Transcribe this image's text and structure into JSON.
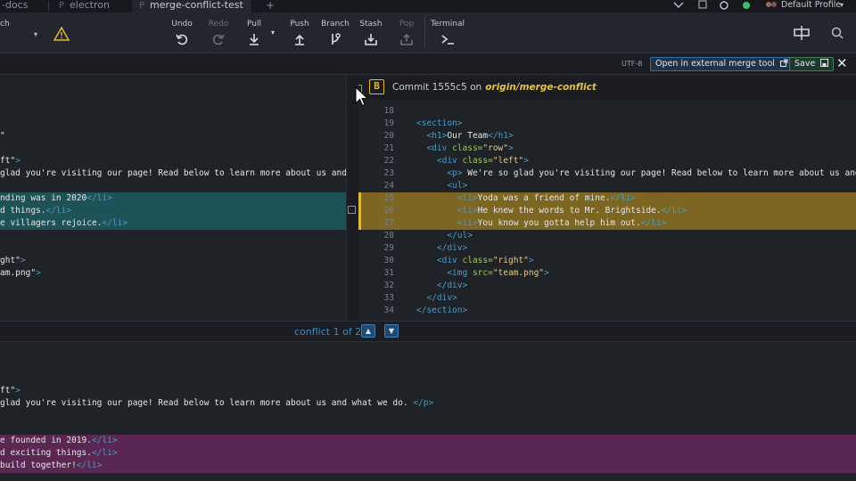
{
  "tabs": [
    {
      "prefix": "",
      "label": "-docs"
    },
    {
      "prefix": "P",
      "label": "electron"
    },
    {
      "prefix": "P",
      "label": "merge-conflict-test"
    }
  ],
  "tab_add": "+",
  "profile": "Default Profile",
  "toolbar": {
    "left_label": "ch",
    "undo": "Undo",
    "redo": "Redo",
    "pull": "Pull",
    "push": "Push",
    "branch": "Branch",
    "stash": "Stash",
    "pop": "Pop",
    "terminal": "Terminal"
  },
  "merge": {
    "encoding": "UTF-8",
    "open_external": "Open in external merge tool",
    "save": "Save",
    "close": "✕"
  },
  "commit": {
    "badge": "B",
    "text": "Commit 1555c5 on",
    "branch": "origin/merge-conflict"
  },
  "left_lines": [
    {
      "text": "\""
    },
    {
      "text": ""
    },
    {
      "text": "ft\">"
    },
    {
      "text": "glad you're visiting our page! Read below to learn more about us and"
    },
    {
      "text": ""
    },
    {
      "text": "nding was in 2020</li>"
    },
    {
      "text": "d things.</li>"
    },
    {
      "text": "e villagers rejoice.</li>"
    },
    {
      "text": ""
    },
    {
      "text": ""
    },
    {
      "text": "ght\">"
    },
    {
      "text": "am.png\">"
    }
  ],
  "right_lines": [
    {
      "n": "18",
      "code": ""
    },
    {
      "n": "19",
      "code": "<section>"
    },
    {
      "n": "20",
      "code": "  <h1>Our Team</h1>"
    },
    {
      "n": "21",
      "code": "  <div class=\"row\">"
    },
    {
      "n": "22",
      "code": "    <div class=\"left\">"
    },
    {
      "n": "23",
      "code": "      <p> We're so glad you're visiting our page! Read below to learn more about us and"
    },
    {
      "n": "24",
      "code": "      <ul>"
    },
    {
      "n": "25",
      "code": "        <li>Yoda was a friend of mine.</li>"
    },
    {
      "n": "26",
      "code": "        <li>He knew the words to Mr. Brightside.</li>"
    },
    {
      "n": "27",
      "code": "        <li>You know you gotta help him out.</li>"
    },
    {
      "n": "28",
      "code": "      </ul>"
    },
    {
      "n": "29",
      "code": "    </div>"
    },
    {
      "n": "30",
      "code": "    <div class=\"right\">"
    },
    {
      "n": "31",
      "code": "      <img src=\"team.png\">"
    },
    {
      "n": "32",
      "code": "    </div>"
    },
    {
      "n": "33",
      "code": "  </div>"
    },
    {
      "n": "34",
      "code": "</section>"
    }
  ],
  "conflict": {
    "text": "conflict 1 of 2",
    "up": "▲",
    "down": "▼"
  },
  "bottom_lines": [
    {
      "text": ""
    },
    {
      "text": ""
    },
    {
      "text": ""
    },
    {
      "text": "ft\">"
    },
    {
      "text": "glad you're visiting our page! Read below to learn more about us and what we do. </p>"
    },
    {
      "text": ""
    },
    {
      "text": ""
    },
    {
      "text": "e founded in 2019.</li>"
    },
    {
      "text": "d exciting things.</li>"
    },
    {
      "text": "build together!</li>"
    }
  ],
  "colors": {
    "conflict_a": "#1d5257",
    "conflict_b": "#7d6622",
    "output_conflict": "#5a2753",
    "accent": "#e2b93b"
  }
}
